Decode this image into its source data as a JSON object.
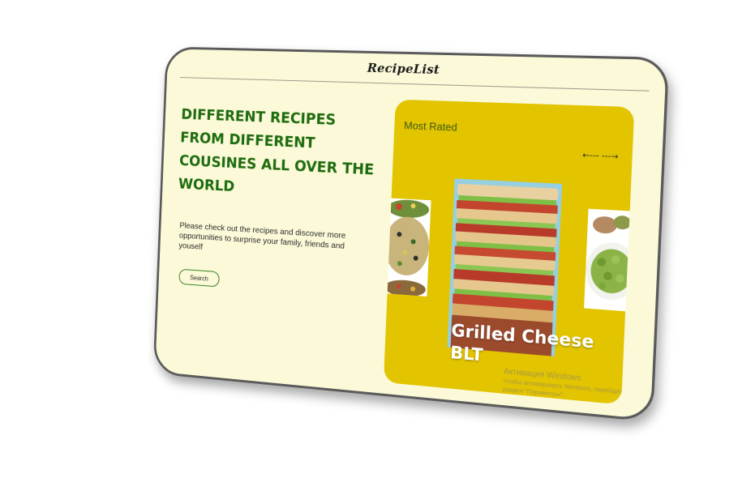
{
  "header": {
    "logo": "RecipeList"
  },
  "hero": {
    "title": "DIFFERENT RECIPES FROM DIFFERENT COUSINES ALL OVER THE WORLD",
    "description": "Please check out the recipes and discover more opportunities to surprise your family, friends and youself",
    "search_label": "Search"
  },
  "most_rated": {
    "title": "Most Rated",
    "nav_arrows": "←--- ---→",
    "dish_name": "Grilled Cheese BLT"
  },
  "watermark": {
    "line1": "Активация Windows",
    "line2": "Чтобы активировать Windows, перейдите в раздел \"Параметры\"."
  },
  "colors": {
    "page_bg": "#fbf9d8",
    "title_green": "#1e6c0f",
    "card_yellow": "#e2c400",
    "bezel": "#5a5a5a"
  }
}
